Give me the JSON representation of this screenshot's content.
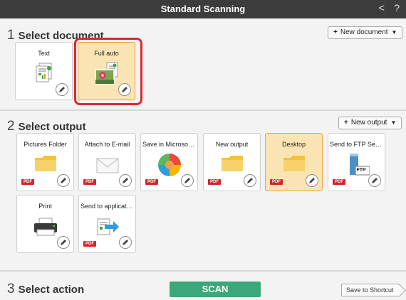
{
  "window": {
    "title": "Standard Scanning",
    "back_glyph": "<",
    "help_glyph": "?"
  },
  "section1": {
    "number": "1",
    "title": "Select document",
    "new_button": {
      "plus": "+",
      "label": "New document"
    },
    "tiles": [
      {
        "label": "Text",
        "icon": "text-document-icon",
        "selected": false
      },
      {
        "label": "Full auto",
        "icon": "photo-document-icon",
        "selected": true
      }
    ]
  },
  "section2": {
    "number": "2",
    "title": "Select output",
    "new_button": {
      "plus": "+",
      "label": "New output"
    },
    "tiles": [
      {
        "label": "Pictures Folder",
        "icon": "folder-icon",
        "badge": "PDF"
      },
      {
        "label": "Attach to E-mail",
        "icon": "envelope-icon",
        "badge": "PDF"
      },
      {
        "label": "Save in Microsoft S...",
        "icon": "sharepoint-icon",
        "badge": "PDF"
      },
      {
        "label": "New output",
        "icon": "folder-icon",
        "badge": "PDF"
      },
      {
        "label": "Desktop",
        "icon": "folder-icon",
        "badge": "PDF",
        "selected": true
      },
      {
        "label": "Send to FTP Server",
        "icon": "ftp-server-icon",
        "badge": "PDF",
        "icon_text": "FTP"
      },
      {
        "label": "Print",
        "icon": "printer-icon"
      },
      {
        "label": "Send to application",
        "icon": "send-to-app-icon",
        "badge": "PDF"
      }
    ]
  },
  "section3": {
    "number": "3",
    "title": "Select action",
    "scan_label": "SCAN",
    "shortcut_label": "Save to Shortcut"
  },
  "colors": {
    "accent_selected": "#fbe4b4",
    "scan_button": "#3aa87a",
    "highlight": "#d82b2b",
    "pdf_badge": "#d8232a"
  }
}
